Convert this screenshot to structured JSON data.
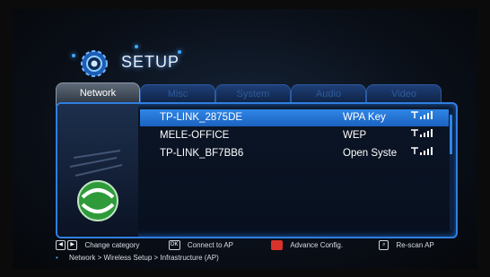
{
  "header": {
    "title": "SETUP",
    "icon": "gear-icon"
  },
  "tabs": [
    {
      "label": "Network",
      "active": true
    },
    {
      "label": "Misc",
      "active": false
    },
    {
      "label": "System",
      "active": false
    },
    {
      "label": "Audio",
      "active": false
    },
    {
      "label": "Video",
      "active": false
    }
  ],
  "networks": [
    {
      "ssid": "TP-LINK_2875DE",
      "security": "WPA Key",
      "signal_icon": "wifi-signal-icon"
    },
    {
      "ssid": "MELE-OFFICE",
      "security": "WEP",
      "signal_icon": "wifi-signal-icon"
    },
    {
      "ssid": "TP-LINK_BF7BB6",
      "security": "Open Syste",
      "signal_icon": "wifi-signal-icon"
    }
  ],
  "footer": {
    "change_category": "Change category",
    "connect": "Connect to AP",
    "advance": "Advance Config.",
    "rescan": "Re-scan AP",
    "ok_key": "OK"
  },
  "breadcrumb": "Network > Wireless Setup > Infrastructure (AP)",
  "colors": {
    "accent": "#2f86e6",
    "red_key": "#d9322b"
  }
}
